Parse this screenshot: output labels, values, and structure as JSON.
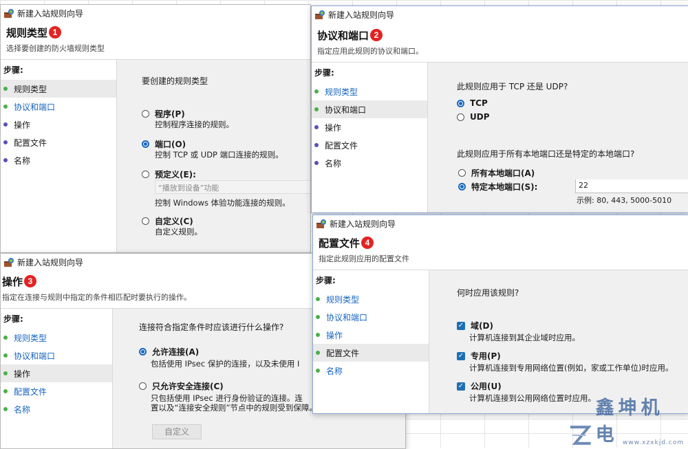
{
  "windows": [
    {
      "title": "新建入站规则向导",
      "badge": "1",
      "heading": "规则类型",
      "desc": "选择要创建的防火墙规则类型",
      "steps_title": "步骤:",
      "steps": [
        "规则类型",
        "协议和端口",
        "操作",
        "配置文件",
        "名称"
      ],
      "question": "要创建的规则类型",
      "options": [
        {
          "label": "程序(P)",
          "desc": "控制程序连接的规则。",
          "selected": false
        },
        {
          "label": "端口(O)",
          "desc": "控制 TCP 或 UDP 端口连接的规则。",
          "selected": true
        },
        {
          "label": "预定义(E):",
          "desc": "控制 Windows 体验功能连接的规则。",
          "selected": false
        },
        {
          "label": "自定义(C)",
          "desc": "自定义规则。",
          "selected": false
        }
      ],
      "predefined_value": "“播放到设备”功能"
    },
    {
      "title": "新建入站规则向导",
      "badge": "2",
      "heading": "协议和端口",
      "desc": "指定应用此规则的协议和端口。",
      "steps_title": "步骤:",
      "steps": [
        "规则类型",
        "协议和端口",
        "操作",
        "配置文件",
        "名称"
      ],
      "question1": "此规则应用于 TCP 还是 UDP?",
      "protocols": [
        {
          "label": "TCP",
          "selected": true
        },
        {
          "label": "UDP",
          "selected": false
        }
      ],
      "question2": "此规则应用于所有本地端口还是特定的本地端口?",
      "ports": [
        {
          "label": "所有本地端口(A)",
          "selected": false
        },
        {
          "label": "特定本地端口(S):",
          "selected": true
        }
      ],
      "port_value": "22",
      "port_example": "示例: 80, 443, 5000-5010"
    },
    {
      "title": "新建入站规则向导",
      "badge": "3",
      "heading": "操作",
      "desc": "指定在连接与规则中指定的条件相匹配时要执行的操作。",
      "steps_title": "步骤:",
      "steps": [
        "规则类型",
        "协议和端口",
        "操作",
        "配置文件",
        "名称"
      ],
      "question": "连接符合指定条件时应该进行什么操作?",
      "options": [
        {
          "label": "允许连接(A)",
          "desc": "包括使用 IPsec 保护的连接，以及未使用 I",
          "selected": true
        },
        {
          "label": "只允许安全连接(C)",
          "desc": "只包括使用 IPsec 进行身份验证的连接。连",
          "desc2": "置以及“连接安全规则”节点中的规则受到保障。",
          "selected": false
        }
      ],
      "custom_button": "自定义"
    },
    {
      "title": "新建入站规则向导",
      "badge": "4",
      "heading": "配置文件",
      "desc": "指定此规则应用的配置文件",
      "steps_title": "步骤:",
      "steps": [
        "规则类型",
        "协议和端口",
        "操作",
        "配置文件",
        "名称"
      ],
      "question": "何时应用该规则?",
      "profiles": [
        {
          "label": "域(D)",
          "desc": "计算机连接到其企业域时应用。",
          "checked": true
        },
        {
          "label": "专用(P)",
          "desc": "计算机连接到专用网络位置(例如，家或工作单位)时应用。",
          "checked": true
        },
        {
          "label": "公用(U)",
          "desc": "计算机连接到公用网络位置时应用。",
          "checked": true
        }
      ]
    }
  ],
  "watermark": {
    "text": "鑫坤机电",
    "url": "www.xzxkjd.com"
  },
  "colors": {
    "accent": "#1565c0",
    "badge": "#e32323",
    "step_green": "#49b04a",
    "step_purple": "#5950b8"
  }
}
